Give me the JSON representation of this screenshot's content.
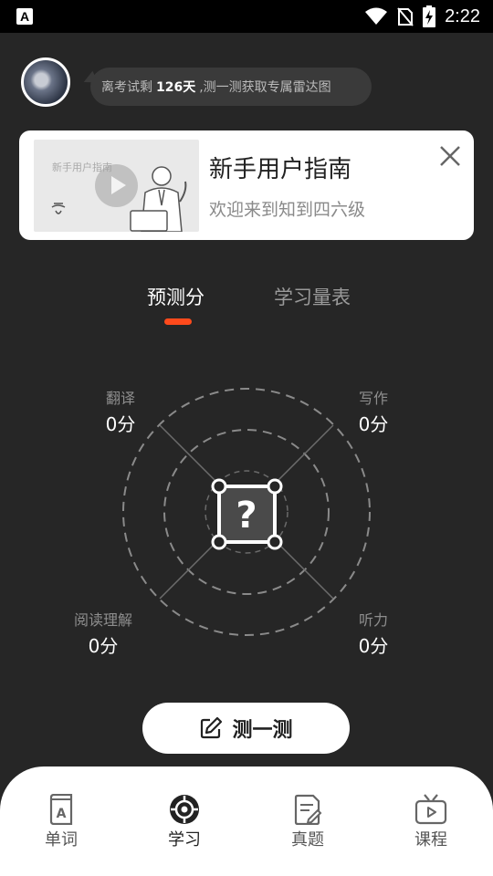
{
  "status_bar": {
    "left_icon": "A",
    "time": "2:22",
    "icons": [
      "wifi-icon",
      "no-sim-icon",
      "battery-charging-icon"
    ]
  },
  "header": {
    "bubble_prefix": "离考试剩",
    "bubble_days": "126天",
    "bubble_suffix": ",测一测获取专属雷达图"
  },
  "guide_card": {
    "thumbnail_text": "新手用户指南",
    "title": "新手用户指南",
    "subtitle": "欢迎来到知到四六级"
  },
  "tabs": [
    {
      "label": "预测分",
      "active": true
    },
    {
      "label": "学习量表",
      "active": false
    }
  ],
  "radar": {
    "scores": {
      "translation": {
        "label": "翻译",
        "value": "0分"
      },
      "writing": {
        "label": "写作",
        "value": "0分"
      },
      "reading": {
        "label": "阅读理解",
        "value": "0分"
      },
      "listening": {
        "label": "听力",
        "value": "0分"
      }
    },
    "center_symbol": "?"
  },
  "test_button": {
    "label": "测一测"
  },
  "bottom_nav": [
    {
      "label": "单词",
      "icon": "word-book-icon",
      "active": false
    },
    {
      "label": "学习",
      "icon": "study-target-icon",
      "active": true
    },
    {
      "label": "真题",
      "icon": "exam-paper-icon",
      "active": false
    },
    {
      "label": "课程",
      "icon": "course-tv-icon",
      "active": false
    }
  ],
  "colors": {
    "background": "#262626",
    "accent": "#ff4a1c",
    "card": "#ffffff"
  }
}
